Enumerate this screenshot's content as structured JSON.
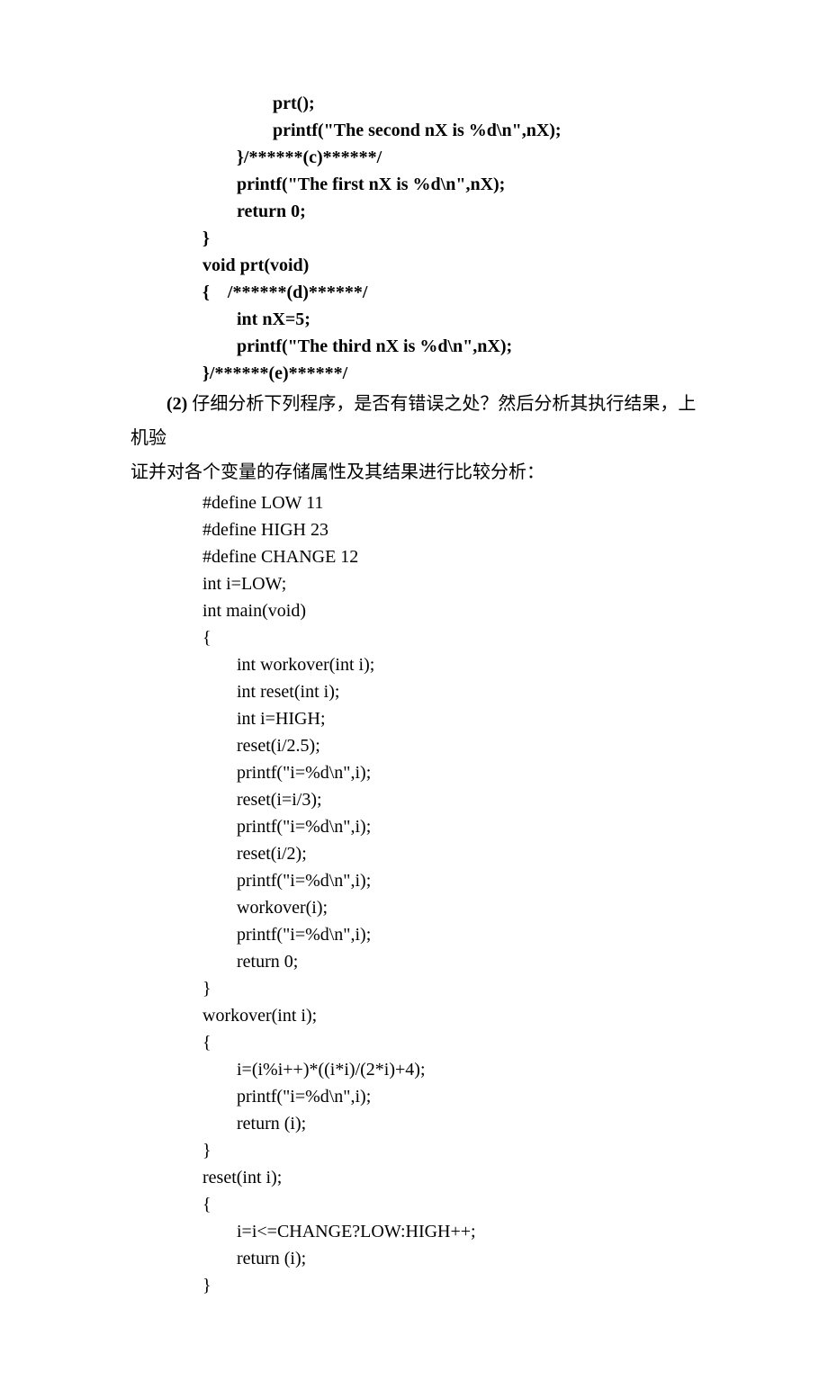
{
  "block1": {
    "l1": "prt();",
    "l2": "printf(\"The second nX is %d\\n\",nX);",
    "l3": "}/******(c)******/",
    "l4": "printf(\"The first nX is %d\\n\",nX);",
    "l5": "return 0;",
    "l6": "}",
    "l7": "void prt(void)",
    "l8": "{    /******(d)******/",
    "l9": "int nX=5;",
    "l10": "printf(\"The third nX is %d\\n\",nX);",
    "l11": "}/******(e)******/"
  },
  "question": {
    "label": "(2)",
    "text_part1": " 仔细分析下列程序，是否有错误之处？然后分析其执行结果，上机验",
    "text_part2": "证并对各个变量的存储属性及其结果进行比较分析："
  },
  "block2": {
    "l1": "#define LOW 11",
    "l2": "#define HIGH 23",
    "l3": "#define CHANGE 12",
    "l4": "int i=LOW;",
    "l5": "int main(void)",
    "l6": "{",
    "l7": "int workover(int i);",
    "l8": "int reset(int i);",
    "l9": "int i=HIGH;",
    "l10": "reset(i/2.5);",
    "l11": "printf(\"i=%d\\n\",i);",
    "l12": "reset(i=i/3);",
    "l13": "printf(\"i=%d\\n\",i);",
    "l14": "reset(i/2);",
    "l15": "printf(\"i=%d\\n\",i);",
    "l16": "workover(i);",
    "l17": "printf(\"i=%d\\n\",i);",
    "l18": "return 0;",
    "l19": "}",
    "l20": "workover(int i);",
    "l21": "{",
    "l22": "i=(i%i++)*((i*i)/(2*i)+4);",
    "l23": "printf(\"i=%d\\n\",i);",
    "l24": "return (i);",
    "l25": "}",
    "l26": "reset(int i);",
    "l27": "{",
    "l28": "i=i<=CHANGE?LOW:HIGH++;",
    "l29": "return (i);",
    "l30": "}"
  }
}
